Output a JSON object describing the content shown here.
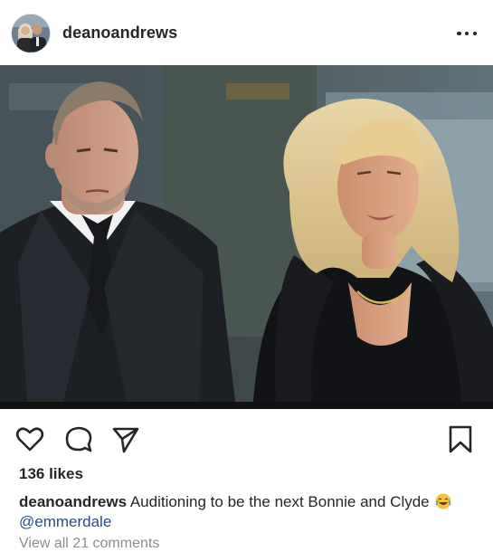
{
  "post": {
    "username": "deanoandrews",
    "likes_text": "136 likes",
    "caption": {
      "username": "deanoandrews",
      "text": " Auditioning to be the next Bonnie and Clyde ",
      "emoji": "face-with-tears-of-joy",
      "mention": "@emmerdale"
    },
    "view_comments": "View all 21 comments"
  },
  "icons": {
    "more": "more-options-icon",
    "like": "heart-icon",
    "comment": "comment-icon",
    "share": "share-icon",
    "save": "bookmark-icon"
  },
  "colors": {
    "text": "#262626",
    "mention": "#2a4d8a",
    "muted": "#8e8e8e"
  }
}
